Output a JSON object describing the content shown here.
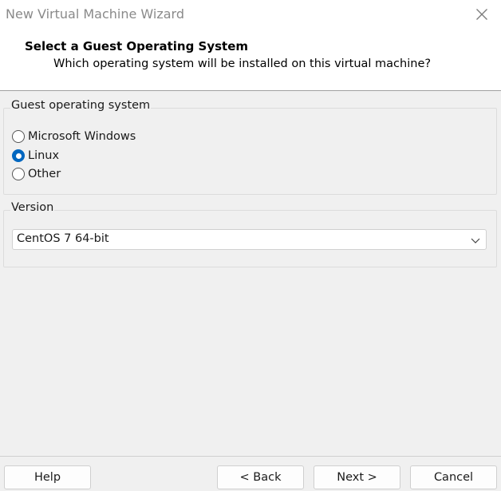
{
  "window": {
    "title": "New Virtual Machine Wizard"
  },
  "header": {
    "title": "Select a Guest Operating System",
    "subtitle": "Which operating system will be installed on this virtual machine?"
  },
  "guest_os": {
    "group_label": "Guest operating system",
    "options": [
      {
        "label": "Microsoft Windows",
        "checked": false
      },
      {
        "label": "Linux",
        "checked": true
      },
      {
        "label": "Other",
        "checked": false
      }
    ]
  },
  "version": {
    "group_label": "Version",
    "selected": "CentOS 7 64-bit"
  },
  "buttons": {
    "help": "Help",
    "back": "< Back",
    "next": "Next >",
    "cancel": "Cancel"
  },
  "colors": {
    "accent": "#0067c0"
  },
  "icons": {
    "close": "close-icon",
    "dropdown": "chevron-down-icon"
  }
}
